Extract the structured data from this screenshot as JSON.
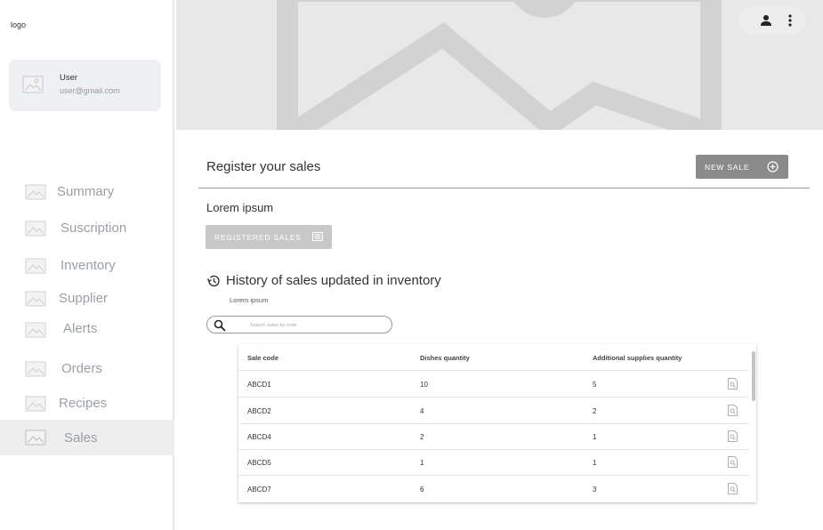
{
  "app": {
    "logo_text": "logo"
  },
  "user": {
    "name": "User",
    "email": "user@gmail.com"
  },
  "sidebar": {
    "items": [
      {
        "label": "Summary",
        "active": false
      },
      {
        "label": "Suscription",
        "active": false
      },
      {
        "label": "Inventory",
        "active": false
      },
      {
        "label": "Supplier",
        "active": false
      },
      {
        "label": "Alerts",
        "active": false
      },
      {
        "label": "Orders",
        "active": false
      },
      {
        "label": "Recipes",
        "active": false
      },
      {
        "label": "Sales",
        "active": true
      }
    ]
  },
  "header": {
    "title": "Register your sales",
    "new_sale_label": "NEW SALE"
  },
  "section": {
    "subtitle": "Lorem ipsum",
    "registered_sales_label": "REGISTERED SALES"
  },
  "history": {
    "title": "History of sales updated in inventory",
    "subtitle": "Lorem ipsum",
    "search_placeholder": "Search sales by code"
  },
  "table": {
    "columns": [
      "Sale code",
      "Dishes quantity",
      "Additional supplies quantity"
    ],
    "rows": [
      [
        "ABCD1",
        "10",
        "5"
      ],
      [
        "ABCD2",
        "4",
        "2"
      ],
      [
        "ABCD4",
        "2",
        "1"
      ],
      [
        "ABCD5",
        "1",
        "1"
      ],
      [
        "ABCD7",
        "6",
        "3"
      ]
    ]
  },
  "icons": {
    "top_actions": [
      "person-icon",
      "more-vert-icon"
    ],
    "new_sale": "add-circle-icon",
    "registered_sales": "list-icon",
    "history": "history-icon",
    "search": "search-icon",
    "row_action": "document-search-icon"
  },
  "colors": {
    "sidebar_text": "#9aa0a6",
    "primary_button": "#8a8a8a",
    "disabled_button": "#c8c8c8",
    "hero_background": "#e8e8e8"
  }
}
